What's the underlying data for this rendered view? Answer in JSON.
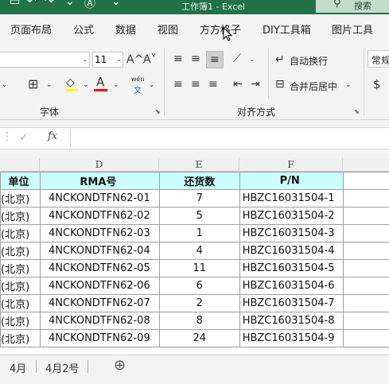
{
  "titlebar": {
    "qat_icons": [
      "save-icon",
      "undo-icon",
      "redo-icon",
      "font-a-icon"
    ],
    "title": "工作簿1  -  Excel",
    "search_label": "搜索"
  },
  "menu": {
    "tabs": [
      "页面布局",
      "公式",
      "数据",
      "视图",
      "方方格子",
      "DIY工具箱",
      "图片工具"
    ]
  },
  "ribbon": {
    "font_size": "11",
    "font_group_label": "字体",
    "align_group_label": "对齐方式",
    "wrap_text_label": "自动换行",
    "merge_center_label": "合并后居中",
    "number_format": "常规",
    "wen_label": "wén",
    "wen_char": "文",
    "currency_symbol": "$",
    "grow_font": "A^",
    "shrink_font": "A˅",
    "font_color_letter": "A",
    "colors": {
      "highlight": "#ffff00",
      "font": "#ff0000"
    }
  },
  "formula_bar": {
    "fx_label": "fx",
    "value": ""
  },
  "sheet": {
    "column_headers": [
      "D",
      "E",
      "F"
    ],
    "header_row": [
      "单位",
      "RMA号",
      "还货数",
      "P/N"
    ],
    "rows": [
      [
        "(北京)",
        "4NCKONDTFN62-01",
        "7",
        "HBZC16031504-1"
      ],
      [
        "(北京)",
        "4NCKONDTFN62-02",
        "5",
        "HBZC16031504-2"
      ],
      [
        "(北京)",
        "4NCKONDTFN62-03",
        "1",
        "HBZC16031504-3"
      ],
      [
        "(北京)",
        "4NCKONDTFN62-04",
        "4",
        "HBZC16031504-4"
      ],
      [
        "(北京)",
        "4NCKONDTFN62-05",
        "11",
        "HBZC16031504-5"
      ],
      [
        "(北京)",
        "4NCKONDTFN62-06",
        "6",
        "HBZC16031504-6"
      ],
      [
        "(北京)",
        "4NCKONDTFN62-07",
        "2",
        "HBZC16031504-7"
      ],
      [
        "(北京)",
        "4NCKONDTFN62-08",
        "8",
        "HBZC16031504-8"
      ],
      [
        "(北京)",
        "4NCKONDTFN62-09",
        "24",
        "HBZC16031504-9"
      ]
    ],
    "tabs": [
      "4月",
      "4月2号"
    ],
    "add_sheet": "⊕"
  }
}
